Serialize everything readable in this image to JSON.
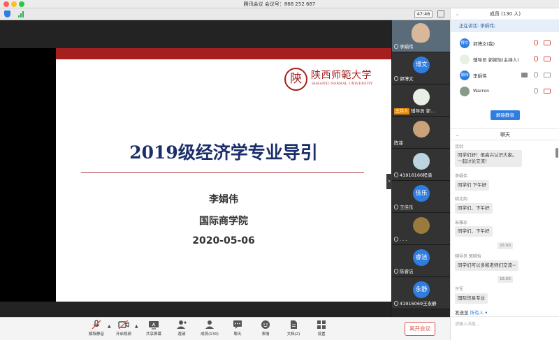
{
  "window": {
    "title": "腾讯会议 会议号：868 252 687"
  },
  "meeting": {
    "timer": "47:46"
  },
  "slide": {
    "logo_seal_char": "陝",
    "logo_name": "陕西师範大学",
    "logo_en": "SHAANXI NORMAL UNIVERSITY",
    "title": "2019级经济学专业导引",
    "presenter": "李娟伟",
    "school": "国际商学院",
    "date": "2020-05-06"
  },
  "video_strip": {
    "tiles": [
      {
        "name": "李娟伟",
        "avatar": "",
        "kind": "video"
      },
      {
        "name": "郭博文",
        "avatar": "博文",
        "kind": "avatar"
      },
      {
        "name": "辅导员 郭...",
        "avatar": "",
        "kind": "image",
        "host_tag": "主持人"
      },
      {
        "name": "陈菲",
        "avatar": "",
        "kind": "image"
      },
      {
        "name": "41916166程渝",
        "avatar": "",
        "kind": "image"
      },
      {
        "name": "王佳乐",
        "avatar": "佳乐",
        "kind": "avatar"
      },
      {
        "name": ". . .",
        "avatar": "",
        "kind": "image"
      },
      {
        "name": "陈睿洁",
        "avatar": "睿洁",
        "kind": "avatar"
      },
      {
        "name": "41916069王永静",
        "avatar": "永静",
        "kind": "avatar"
      }
    ]
  },
  "toolbar": {
    "items": [
      {
        "label": "解除静音",
        "icon": "mic-muted-icon"
      },
      {
        "label": "开启视频",
        "icon": "camera-off-icon"
      },
      {
        "label": "共享屏幕",
        "icon": "share-screen-icon"
      },
      {
        "label": "邀请",
        "icon": "invite-icon"
      },
      {
        "label": "成员(130)",
        "icon": "members-icon"
      },
      {
        "label": "聊天",
        "icon": "chat-icon"
      },
      {
        "label": "表情",
        "icon": "emoji-icon"
      },
      {
        "label": "文档(2)",
        "icon": "document-icon"
      },
      {
        "label": "设置",
        "icon": "settings-icon"
      }
    ],
    "leave_label": "离开会议"
  },
  "members_panel": {
    "header": "成员 (130 人)",
    "speaking": "正在讲话: 李娟伟;",
    "members": [
      {
        "avatar": "博文",
        "name": "郭博文(我)"
      },
      {
        "avatar": "",
        "name": "辅导员 郭婉怡(主持人)"
      },
      {
        "avatar": "娟伟",
        "name": "李娟伟"
      },
      {
        "avatar": "",
        "name": "Warren"
      }
    ],
    "unmute_all": "解除静音"
  },
  "chat_panel": {
    "header": "聊天",
    "messages": [
      {
        "sender": "沈剑",
        "text": "同学们好！很高兴认识大家。一起讨论交流！"
      },
      {
        "sender": "李娟伟",
        "text": "同学们 下午好"
      },
      {
        "sender": "姚北韵",
        "text": "同学们、下午好"
      },
      {
        "sender": "朱雅珍",
        "text": "同学们、下午好"
      },
      {
        "sender": "辅导员 郭婉怡",
        "text": "同学们可以多和老师们交流~"
      },
      {
        "sender": "许军",
        "text": "国际贸易专业"
      }
    ],
    "times": [
      "15:50",
      "15:50"
    ],
    "send_to_label": "发送至",
    "send_to_target": "所有人",
    "input_placeholder": "请输入消息..."
  },
  "colors": {
    "accent": "#2f7de1",
    "slide_red": "#a51f1f",
    "slide_title": "#1b2e6b",
    "leave": "#d9534f"
  }
}
